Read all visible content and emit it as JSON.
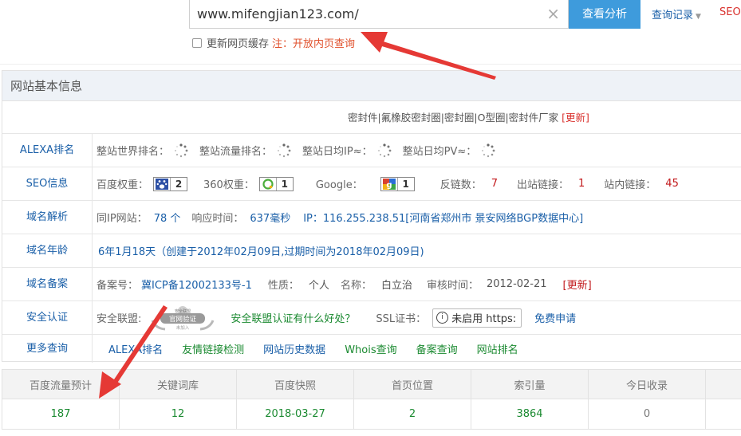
{
  "search": {
    "value": "www.mifengjian123.com/",
    "clear_icon": "×",
    "analyze_label": "查看分析",
    "history_label": "查询记录",
    "seo_label": "SEO"
  },
  "cache": {
    "label": "更新网页缓存",
    "note": "注：开放内页查询"
  },
  "panel": {
    "title": "网站基本信息",
    "products": "密封件|氟橡胶密封圈|密封圈|O型圈|密封件厂家",
    "update_label": "[更新]"
  },
  "alexa": {
    "label": "ALEXA排名",
    "world_rank": "整站世界排名：",
    "traffic_rank": "整站流量排名：",
    "daily_ip": "整站日均IP≈：",
    "daily_pv": "整站日均PV≈："
  },
  "seo": {
    "label": "SEO信息",
    "baidu_label": "百度权重：",
    "baidu_value": "2",
    "s360_label": "360权重：",
    "s360_value": "1",
    "google_label": "Google：",
    "google_value": "1",
    "backlinks_label": "反链数：",
    "backlinks_value": "7",
    "outbound_label": "出站链接：",
    "outbound_value": "1",
    "internal_label": "站内链接：",
    "internal_value": "45"
  },
  "dns": {
    "label": "域名解析",
    "same_ip_label": "同IP网站：",
    "same_ip_value": "78 个",
    "response_label": "响应时间：",
    "response_value": "637毫秒",
    "ip_text": "IP：116.255.238.51[河南省郑州市 景安网络BGP数据中心]"
  },
  "age": {
    "label": "域名年龄",
    "text": "6年1月18天（创建于2012年02月09日,过期时间为2018年02月09日)"
  },
  "icp": {
    "label": "域名备案",
    "record_label": "备案号：",
    "record_value": "冀ICP备12002133号-1",
    "nature_label": "性质：",
    "nature_value": "个人",
    "name_label": "名称：",
    "name_value": "白立治",
    "audit_label": "审核时间：",
    "audit_value": "2012-02-21",
    "update_label": "[更新]"
  },
  "security": {
    "label": "安全认证",
    "alliance_label": "安全联盟:",
    "seal_top": "安全联盟",
    "seal_main": "官网验证",
    "seal_sub": "未加入",
    "alliance_link": "安全联盟认证有什么好处？",
    "ssl_label": "SSL证书：",
    "ssl_status": "未启用 https:",
    "free_apply": "免费申请"
  },
  "more": {
    "label": "更多查询",
    "links": [
      "ALEXA排名",
      "友情链接检测",
      "网站历史数据",
      "Whois查询",
      "备案查询",
      "网站排名"
    ]
  },
  "stats": {
    "headers": [
      "百度流量预计",
      "关键词库",
      "百度快照",
      "首页位置",
      "索引量",
      "今日收录"
    ],
    "values": [
      "187",
      "12",
      "2018-03-27",
      "2",
      "3864",
      "0"
    ]
  },
  "colors": {
    "accent_blue": "#3e9bdc",
    "link_blue": "#1a5fa8",
    "value_red": "#c2191c",
    "value_green": "#1b8a31",
    "arrow_red": "#e53935"
  }
}
